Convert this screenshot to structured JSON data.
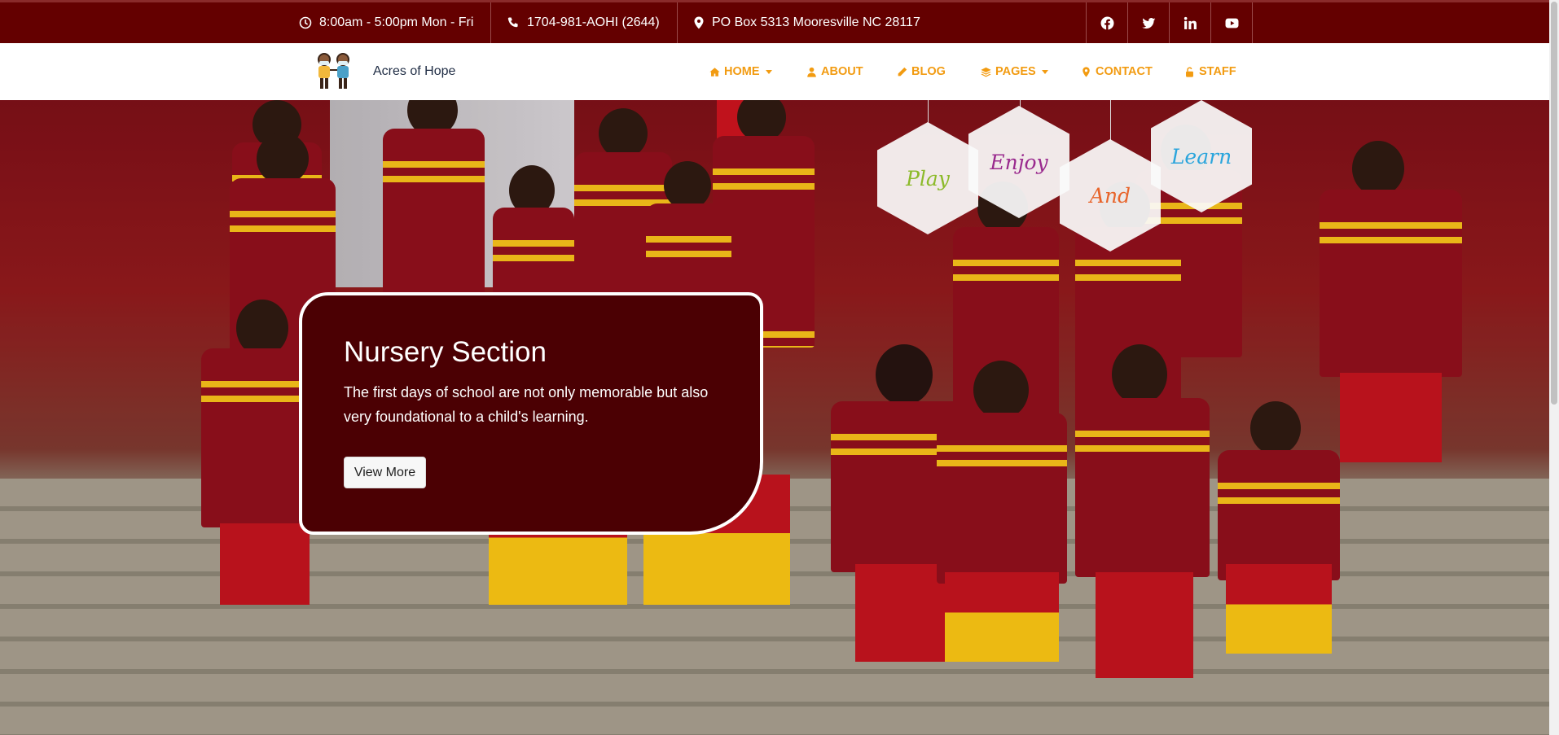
{
  "topbar": {
    "hours": "8:00am - 5:00pm Mon - Fri",
    "phone": "1704-981-AOHI (2644)",
    "address": "PO Box 5313 Mooresville NC 28117",
    "social": [
      "facebook-icon",
      "twitter-icon",
      "linkedin-icon",
      "youtube-icon"
    ]
  },
  "brand": {
    "name": "Acres of Hope"
  },
  "nav": {
    "items": [
      {
        "label": "HOME",
        "icon": "home-icon",
        "dropdown": true
      },
      {
        "label": "ABOUT",
        "icon": "user-icon",
        "dropdown": false
      },
      {
        "label": "BLOG",
        "icon": "pencil-icon",
        "dropdown": false
      },
      {
        "label": "PAGES",
        "icon": "layers-icon",
        "dropdown": true
      },
      {
        "label": "CONTACT",
        "icon": "map-marker-icon",
        "dropdown": false
      },
      {
        "label": "STAFF",
        "icon": "unlock-icon",
        "dropdown": false
      }
    ]
  },
  "hexagons": [
    {
      "word": "Play",
      "color": "#8cba2a"
    },
    {
      "word": "Enjoy",
      "color": "#9a2a8e"
    },
    {
      "word": "And",
      "color": "#e8642a"
    },
    {
      "word": "Learn",
      "color": "#2aa5dc"
    }
  ],
  "hero": {
    "title": "Nursery Section",
    "text": "The first days of school are not only memorable but also very foundational to a child's learning.",
    "button": "View More"
  },
  "colors": {
    "topbar": "#640000",
    "accent": "#f29b11",
    "card": "#4b0003"
  }
}
